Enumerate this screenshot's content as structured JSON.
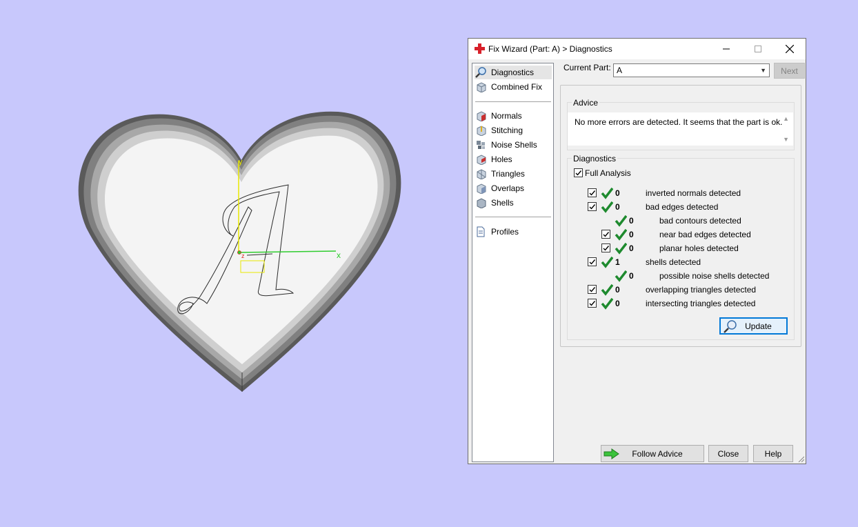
{
  "window": {
    "title": "Fix Wizard (Part: A) > Diagnostics",
    "minimize_glyph": "—",
    "maximize_glyph": "☐",
    "close_glyph": "✕"
  },
  "viewport": {
    "axis_x_label": "x",
    "axis_y_label": "y",
    "axis_z_label": "z",
    "part_letter": "A"
  },
  "nav": {
    "items": [
      {
        "label": "Diagnostics",
        "icon": "magnifier-icon"
      },
      {
        "label": "Combined Fix",
        "icon": "cube-icon"
      },
      {
        "label": "Normals",
        "icon": "normals-cube-icon"
      },
      {
        "label": "Stitching",
        "icon": "stitching-cube-icon"
      },
      {
        "label": "Noise Shells",
        "icon": "noise-shells-icon"
      },
      {
        "label": "Holes",
        "icon": "holes-cube-icon"
      },
      {
        "label": "Triangles",
        "icon": "triangles-cube-icon"
      },
      {
        "label": "Overlaps",
        "icon": "overlaps-cube-icon"
      },
      {
        "label": "Shells",
        "icon": "shells-cube-icon"
      },
      {
        "label": "Profiles",
        "icon": "document-icon"
      }
    ]
  },
  "header": {
    "current_part_label": "Current Part:",
    "current_part_value": "A",
    "next_label": "Next"
  },
  "advice": {
    "title": "Advice",
    "text": "No more errors are detected. It seems that the part is ok."
  },
  "diagnostics": {
    "title": "Diagnostics",
    "full_analysis_label": "Full Analysis",
    "rows": [
      {
        "count": "0",
        "label": "inverted normals detected"
      },
      {
        "count": "0",
        "label": "bad edges detected"
      },
      {
        "count": "0",
        "label": "bad contours detected"
      },
      {
        "count": "0",
        "label": "near bad edges detected"
      },
      {
        "count": "0",
        "label": "planar holes detected"
      },
      {
        "count": "1",
        "label": "shells detected"
      },
      {
        "count": "0",
        "label": "possible noise shells detected"
      },
      {
        "count": "0",
        "label": "overlapping triangles detected"
      },
      {
        "count": "0",
        "label": "intersecting triangles detected"
      }
    ],
    "update_label": "Update"
  },
  "footer": {
    "follow_advice_label": "Follow Advice",
    "close_label": "Close",
    "help_label": "Help"
  },
  "colors": {
    "background": "#c8c8fc",
    "tick_green": "#1e8a2e",
    "accent_blue": "#0078d7",
    "title_icon_red": "#d8202a"
  }
}
